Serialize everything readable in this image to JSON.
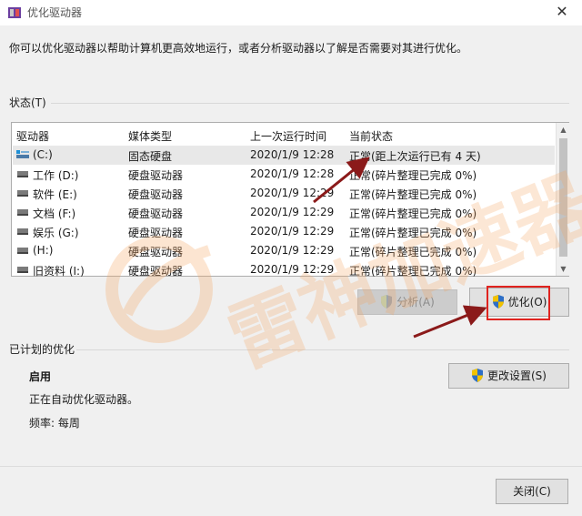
{
  "window": {
    "title": "优化驱动器",
    "close_glyph": "✕"
  },
  "intro": "你可以优化驱动器以帮助计算机更高效地运行，或者分析驱动器以了解是否需要对其进行优化。",
  "status": {
    "label": "状态(T)",
    "columns": [
      "驱动器",
      "媒体类型",
      "上一次运行时间",
      "当前状态"
    ],
    "rows": [
      {
        "icon": "ssd-drive-icon",
        "drive": "(C:)",
        "media": "固态硬盘",
        "last_run": "2020/1/9 12:28",
        "state": "正常(距上次运行已有 4 天)"
      },
      {
        "icon": "hard-drive-icon",
        "drive": "工作 (D:)",
        "media": "硬盘驱动器",
        "last_run": "2020/1/9 12:28",
        "state": "正常(碎片整理已完成 0%)"
      },
      {
        "icon": "hard-drive-icon",
        "drive": "软件 (E:)",
        "media": "硬盘驱动器",
        "last_run": "2020/1/9 12:29",
        "state": "正常(碎片整理已完成 0%)"
      },
      {
        "icon": "hard-drive-icon",
        "drive": "文档 (F:)",
        "media": "硬盘驱动器",
        "last_run": "2020/1/9 12:29",
        "state": "正常(碎片整理已完成 0%)"
      },
      {
        "icon": "hard-drive-icon",
        "drive": "娱乐 (G:)",
        "media": "硬盘驱动器",
        "last_run": "2020/1/9 12:29",
        "state": "正常(碎片整理已完成 0%)"
      },
      {
        "icon": "hard-drive-icon",
        "drive": "(H:)",
        "media": "硬盘驱动器",
        "last_run": "2020/1/9 12:29",
        "state": "正常(碎片整理已完成 0%)"
      },
      {
        "icon": "hard-drive-icon",
        "drive": "旧资料 (I:)",
        "media": "硬盘驱动器",
        "last_run": "2020/1/9 12:29",
        "state": "正常(碎片整理已完成 0%)"
      }
    ]
  },
  "buttons": {
    "analyze": "分析(A)",
    "optimize": "优化(O)",
    "change_settings": "更改设置(S)",
    "close": "关闭(C)"
  },
  "scheduled": {
    "label": "已计划的优化",
    "enabled": "启用",
    "auto_text": "正在自动优化驱动器。",
    "frequency": "频率: 每周"
  },
  "watermark": {
    "text": "雷神加速器"
  },
  "colors": {
    "annotation_red": "#e0231f",
    "arrow_darkred": "#8b1a1a",
    "watermark_orange": "#f7a35c",
    "shield_blue": "#2e6fc7",
    "shield_yellow": "#f2c200"
  }
}
